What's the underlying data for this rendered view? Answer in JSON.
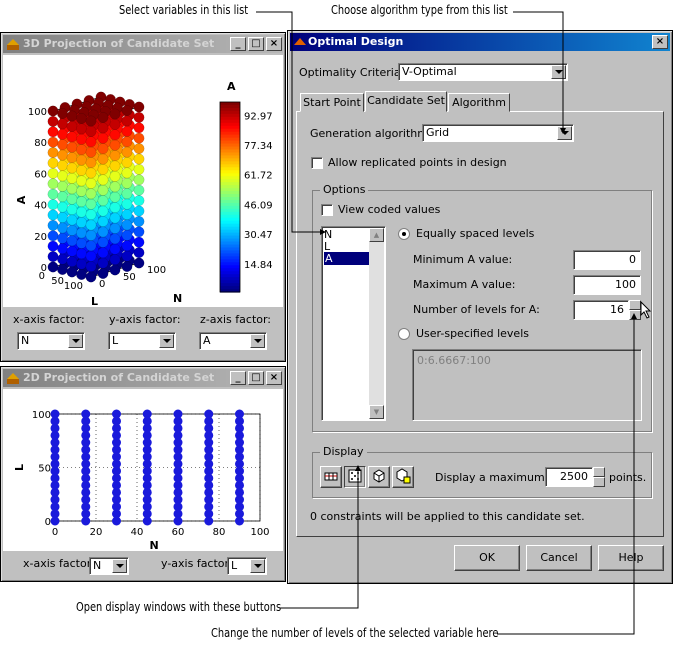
{
  "callouts": {
    "select_vars": "Select variables in this list",
    "choose_alg": "Choose algorithm type from this list",
    "open_display": "Open display windows with these buttons",
    "change_levels": "Change the number of levels of the selected variable here"
  },
  "win3d": {
    "title": "3D Projection of Candidate Set",
    "zlabel": "A",
    "xlabel": "L",
    "ylabel": "N",
    "zticks": [
      "100",
      "80",
      "60",
      "40",
      "20",
      "0"
    ],
    "xticks": [
      "100",
      "50",
      "0"
    ],
    "yticks": [
      "0",
      "50",
      "100"
    ],
    "colorbar_title": "A",
    "colorbar_ticks": [
      "92.97",
      "77.34",
      "61.72",
      "46.09",
      "30.47",
      "14.84"
    ],
    "x_factor_label": "x-axis factor:",
    "y_factor_label": "y-axis factor:",
    "z_factor_label": "z-axis factor:",
    "x_factor": "N",
    "y_factor": "L",
    "z_factor": "A"
  },
  "win2d": {
    "title": "2D Projection of Candidate Set",
    "ylabel": "L",
    "xlabel": "N",
    "yticks": [
      "100",
      "50",
      "0"
    ],
    "xticks": [
      "0",
      "20",
      "40",
      "60",
      "80",
      "100"
    ],
    "x_factor_label": "x-axis factor:",
    "y_factor_label": "y-axis factor:",
    "x_factor": "N",
    "y_factor": "L"
  },
  "dialog": {
    "title": "Optimal Design",
    "criteria_label": "Optimality Criteria:",
    "criteria_value": "V-Optimal",
    "tabs": [
      "Start Point",
      "Candidate Set",
      "Algorithm"
    ],
    "gen_alg_label": "Generation algorithm:",
    "gen_alg_value": "Grid",
    "allow_replicated": "Allow replicated points in design",
    "options_title": "Options",
    "view_coded": "View coded values",
    "variables": [
      "N",
      "L",
      "A"
    ],
    "equally_spaced": "Equally spaced levels",
    "min_label": "Minimum A value:",
    "min_value": "0",
    "max_label": "Maximum A value:",
    "max_value": "100",
    "levels_label": "Number of levels for A:",
    "levels_value": "16",
    "user_levels": "User-specified levels",
    "user_levels_value": "0:6.6667:100",
    "display_title": "Display",
    "display_max_label": "Display a maximum of",
    "display_max_value": "2500",
    "points_label": "points.",
    "constraints_text": "0 constraints will be applied to this candidate set.",
    "ok": "OK",
    "cancel": "Cancel",
    "help": "Help"
  },
  "chart_data": [
    {
      "type": "scatter",
      "dimensions": 3,
      "x_name": "L",
      "y_name": "N",
      "z_name": "A",
      "x_range": [
        0,
        100
      ],
      "y_range": [
        0,
        100
      ],
      "z_range": [
        0,
        100
      ],
      "colorbar": {
        "label": "A",
        "ticks": [
          14.84,
          30.47,
          46.09,
          61.72,
          77.34,
          92.97
        ]
      },
      "z_levels": [
        0,
        6.6667,
        13.3333,
        20,
        26.6667,
        33.3333,
        40,
        46.6667,
        53.3333,
        60,
        66.6667,
        73.3333,
        80,
        86.6667,
        93.3333,
        100
      ]
    },
    {
      "type": "scatter",
      "x_name": "N",
      "y_name": "L",
      "x_range": [
        0,
        100
      ],
      "y_range": [
        0,
        100
      ],
      "x_levels": [
        0,
        15,
        30,
        45,
        60,
        75,
        90
      ],
      "marker_color": "#1a1adb"
    }
  ]
}
